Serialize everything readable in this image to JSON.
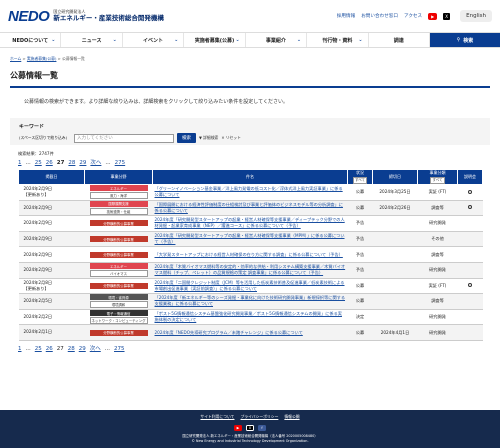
{
  "header": {
    "logo": "NEDO",
    "org_small": "国立研究開発法人",
    "org_big": "新エネルギー・産業技術総合開発機構",
    "links": [
      "採用情報",
      "お問い合わせ窓口",
      "アクセス"
    ],
    "english": "English",
    "sns_icons": [
      "youtube-icon",
      "x-icon"
    ]
  },
  "nav": {
    "items": [
      "NEDOについて",
      "ニュース",
      "イベント",
      "実施者募集(公募)",
      "事業紹介",
      "刊行物・資料",
      "調達"
    ],
    "search": "検索"
  },
  "breadcrumb": [
    "ホーム",
    "実施者募集(公募)",
    "公募情報一覧"
  ],
  "page_title": "公募情報一覧",
  "description": "公募情報の検索ができます。より詳細な絞り込みは、詳細検索をクリックして絞り込みたい条件を設定してください。",
  "keyword": {
    "title": "キーワード",
    "label": "(スペース区切りで絞り込み)",
    "placeholder": "入力してください",
    "button": "検索",
    "detail": "▼ 詳細検索",
    "reset": "✕ リセット"
  },
  "result_count": "検索結果：2747件",
  "pager": [
    "1",
    "...",
    "25",
    "26",
    "27",
    "28",
    "29",
    "次へ",
    "...",
    "275"
  ],
  "pager_current": "27",
  "table": {
    "headers": {
      "date": "掲載日",
      "category": "事業分野",
      "title": "件名",
      "status": "状況",
      "status_sel": "すべて",
      "deadline": "締切日",
      "type": "事業分類",
      "type_sel": "すべて",
      "session": "説明会"
    },
    "rows": [
      {
        "date": "2024年2月9日",
        "updated": "【更新あり】",
        "tag": "エネルギー",
        "tag2": "風力・海洋",
        "tag_color": "#e0454f",
        "title": "「グリーンイノベーション基金事業／洋上風力発電の低コスト化／浮体式洋上風力実証事業」に係る公募について",
        "status": "公募",
        "deadline": "2024年3月25日",
        "type": "実証 (FT)",
        "session": "○"
      },
      {
        "date": "2024年2月9日",
        "updated": "",
        "tag": "国際展開支援",
        "tag2": "技術連携・仕組",
        "tag_color": "#e0454f",
        "title": "「国際展開における経済性評価制度の仕組検討及び事業と評価体のビジネスモデル等の分析調査」に係る公募について",
        "status": "公募",
        "deadline": "2024年2月26日",
        "type": "調査等",
        "session": "○"
      },
      {
        "date": "2024年2月9日",
        "updated": "",
        "tag": "分野横断的公募事業",
        "tag2": "",
        "tag_color": "#c0392b",
        "title": "2024年度「研究開発型スタートアップの起業・経営人材確保等支援事業／ディープテック分野での人材発掘・起業家育成事業（NEP）／躍進コース」に係る公募について（予告）",
        "status": "予告",
        "deadline": "",
        "type": "研究開発",
        "session": ""
      },
      {
        "date": "2024年2月9日",
        "updated": "",
        "tag": "分野横断的公募事業",
        "tag2": "",
        "tag_color": "#c0392b",
        "title": "2024年度「研究開発型スタートアップの起業・経営人材確保等支援事業（MPM）」に係る公募について（予告）",
        "status": "予告",
        "deadline": "",
        "type": "その他",
        "session": ""
      },
      {
        "date": "2024年2月9日",
        "updated": "",
        "tag": "分野横断的公募事業",
        "tag2": "",
        "tag_color": "#c0392b",
        "title": "「大学発スタートアップにおける経営人材確保の在り方に関する調査」に係る公募について（予告）",
        "status": "予告",
        "deadline": "",
        "type": "調査等",
        "session": ""
      },
      {
        "date": "2024年2月9日",
        "updated": "",
        "tag": "エネルギー",
        "tag2": "バイオマス",
        "tag_color": "#e0454f",
        "title": "2024年度「木質バイオマス燃料等の安定的・効率的な供給・利用システム構築支援事業／木質バイオマス燃料（チップ、ペレット）の品質規格の策定 調査事業」に係る公募について（予告）",
        "status": "予告",
        "deadline": "",
        "type": "研究開発",
        "session": ""
      },
      {
        "date": "2024年2月8日",
        "updated": "【更新あり】",
        "tag": "分野横断的公募事業",
        "tag2": "",
        "tag_color": "#c0392b",
        "title": "2024年度「二国間クレジット制度（JCM）等を活用した低炭素技術普及促進事業／低炭素技術による市場創出促進事業（実証前調査）」に係る公募について",
        "status": "公募",
        "deadline": "",
        "type": "実証 (FT)",
        "session": "○"
      },
      {
        "date": "2024年2月5日",
        "updated": "",
        "tag": "環境・省資源",
        "tag2": "環境調和",
        "tag_color": "#555",
        "title": "「2024年度「新エネルギー等のシーズ発掘・事業化に向けた技術研究開発事業」新規採択等に関する支援業務」に係る公募について",
        "status": "公募",
        "deadline": "",
        "type": "調査等",
        "session": ""
      },
      {
        "date": "2024年2月2日",
        "updated": "",
        "tag": "電子・情報通信",
        "tag2": "ネットワーク・コンピューティング",
        "tag_color": "#333",
        "title": "「ポスト5G情報通信システム基盤強化研究開発事業／ポスト5G情報通信システムの開発」に係る実施体制の決定について",
        "status": "決定",
        "deadline": "",
        "type": "研究開発",
        "session": ""
      },
      {
        "date": "2024年2月1日",
        "updated": "",
        "tag": "分野横断的公募事業",
        "tag2": "",
        "tag_color": "#c0392b",
        "title": "2024年度「NEDO先導研究プログラム／未踏チャレンジ」に係る公募について",
        "status": "公募",
        "deadline": "2024年4月1日",
        "type": "研究開発",
        "session": ""
      }
    ]
  },
  "footer": {
    "links": [
      "サイト利用について",
      "プライバシーポリシー",
      "情報公開"
    ],
    "sns_icons": [
      "youtube-icon",
      "x-icon",
      "facebook-icon"
    ],
    "copy1": "国立研究開発法人 新エネルギー・産業技術総合開発機構（法人番号 2020005008480）",
    "copy2": "© New Energy and Industrial Technology Development Organization."
  }
}
